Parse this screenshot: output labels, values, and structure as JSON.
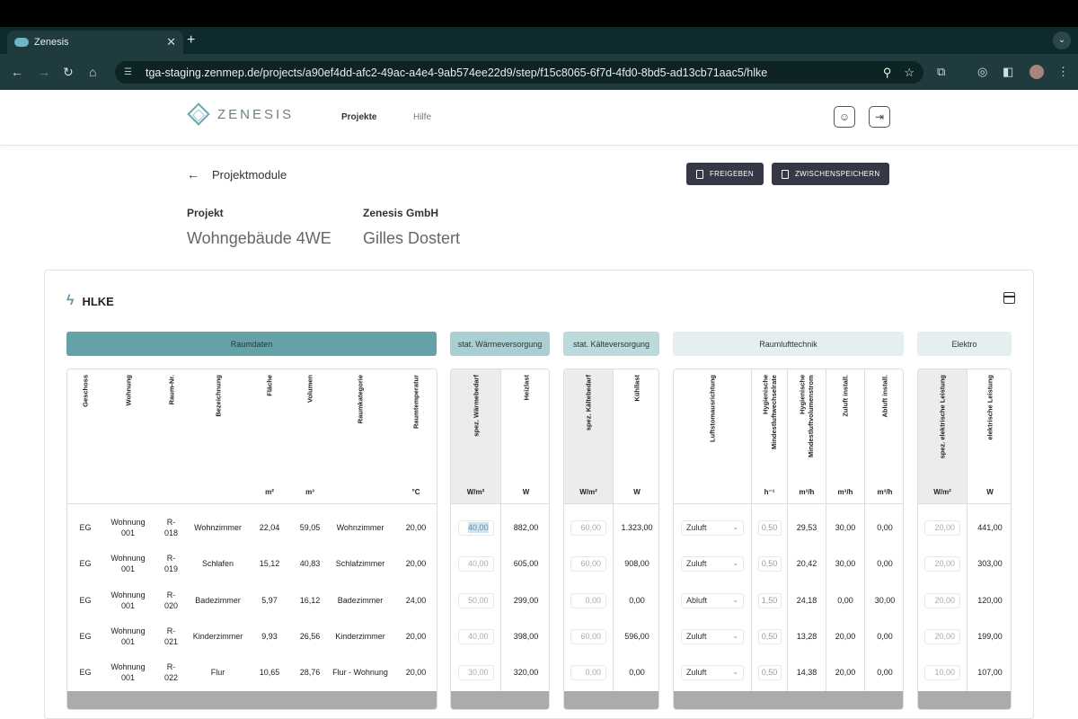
{
  "browser": {
    "tab_title": "Zenesis",
    "url": "tga-staging.zenmep.de/projects/a90ef4dd-afc2-49ac-a4e4-9ab574ee22d9/step/f15c8065-6f7d-4fd0-8bd5-ad13cb71aac5/hlke"
  },
  "app": {
    "brand": "ZENESIS",
    "menu_projects": "Projekte",
    "menu_help": "Hilfe"
  },
  "page": {
    "back_label": "Projektmodule",
    "btn_release": "FREIGEBEN",
    "btn_save": "ZWISCHENSPEICHERN",
    "project_label": "Projekt",
    "project_name": "Wohngebäude 4WE",
    "company_label": "Zenesis GmbH",
    "company_user": "Gilles Dostert"
  },
  "module": {
    "title": "HLKE"
  },
  "groups": [
    "Raumdaten",
    "stat. Wärmeversorgung",
    "stat. Kälteversorgung",
    "Raumlufttechnik",
    "Elektro"
  ],
  "columns": {
    "geschoss": {
      "label": "Geschoss",
      "unit": ""
    },
    "wohnung": {
      "label": "Wohnung",
      "unit": ""
    },
    "raumnr": {
      "label": "Raum-Nr.",
      "unit": ""
    },
    "bez": {
      "label": "Bezeichnung",
      "unit": ""
    },
    "flaeche": {
      "label": "Fläche",
      "unit": "m²"
    },
    "volumen": {
      "label": "Volumen",
      "unit": "m³"
    },
    "kat": {
      "label": "Raumkategorie",
      "unit": ""
    },
    "temp": {
      "label": "Raumtemperatur",
      "unit": "°C"
    },
    "swb": {
      "label": "spez. Wärmebedarf",
      "unit": "W/m²"
    },
    "heiz": {
      "label": "Heizlast",
      "unit": "W"
    },
    "skb": {
      "label": "spez. Kältebedarf",
      "unit": "W/m²"
    },
    "kuehl": {
      "label": "Kühllast",
      "unit": "W"
    },
    "lr": {
      "label": "Luftstomausrichtung",
      "unit": ""
    },
    "hmlw": {
      "label": "Hygienische Mindestluftwechselrate",
      "unit": "h⁻¹"
    },
    "hmlv": {
      "label": "Hygienische Mindestluftvolumenstrom",
      "unit": "m³/h"
    },
    "zu": {
      "label": "Zuluft install.",
      "unit": "m³/h"
    },
    "ab": {
      "label": "Abluft install.",
      "unit": "m³/h"
    },
    "sel": {
      "label": "spez. elektrische Leistung",
      "unit": "W/m²"
    },
    "el": {
      "label": "elektrische Leistung",
      "unit": "W"
    }
  },
  "rows": [
    {
      "geschoss": "EG",
      "wohnung": "Wohnung 001",
      "raumnr": "R-018",
      "bez": "Wohnzimmer",
      "flaeche": "22,04",
      "volumen": "59,05",
      "kat": "Wohnzimmer",
      "temp": "20,00",
      "swb": "40,00",
      "heiz": "882,00",
      "skb": "60,00",
      "kuehl": "1.323,00",
      "lr": "Zuluft",
      "hmlw": "0,50",
      "hmlv": "29,53",
      "zu": "30,00",
      "ab": "0,00",
      "sel": "20,00",
      "el": "441,00"
    },
    {
      "geschoss": "EG",
      "wohnung": "Wohnung 001",
      "raumnr": "R-019",
      "bez": "Schlafen",
      "flaeche": "15,12",
      "volumen": "40,83",
      "kat": "Schlafzimmer",
      "temp": "20,00",
      "swb": "40,00",
      "heiz": "605,00",
      "skb": "60,00",
      "kuehl": "908,00",
      "lr": "Zuluft",
      "hmlw": "0,50",
      "hmlv": "20,42",
      "zu": "30,00",
      "ab": "0,00",
      "sel": "20,00",
      "el": "303,00"
    },
    {
      "geschoss": "EG",
      "wohnung": "Wohnung 001",
      "raumnr": "R-020",
      "bez": "Badezimmer",
      "flaeche": "5,97",
      "volumen": "16,12",
      "kat": "Badezimmer",
      "temp": "24,00",
      "swb": "50,00",
      "heiz": "299,00",
      "skb": "0,00",
      "kuehl": "0,00",
      "lr": "Abluft",
      "hmlw": "1,50",
      "hmlv": "24,18",
      "zu": "0,00",
      "ab": "30,00",
      "sel": "20,00",
      "el": "120,00"
    },
    {
      "geschoss": "EG",
      "wohnung": "Wohnung 001",
      "raumnr": "R-021",
      "bez": "Kinderzimmer",
      "flaeche": "9,93",
      "volumen": "26,56",
      "kat": "Kinderzimmer",
      "temp": "20,00",
      "swb": "40,00",
      "heiz": "398,00",
      "skb": "60,00",
      "kuehl": "596,00",
      "lr": "Zuluft",
      "hmlw": "0,50",
      "hmlv": "13,28",
      "zu": "20,00",
      "ab": "0,00",
      "sel": "20,00",
      "el": "199,00"
    },
    {
      "geschoss": "EG",
      "wohnung": "Wohnung 001",
      "raumnr": "R-022",
      "bez": "Flur",
      "flaeche": "10,65",
      "volumen": "28,76",
      "kat": "Flur - Wohnung",
      "temp": "20,00",
      "swb": "30,00",
      "heiz": "320,00",
      "skb": "0,00",
      "kuehl": "0,00",
      "lr": "Zuluft",
      "hmlw": "0,50",
      "hmlv": "14,38",
      "zu": "20,00",
      "ab": "0,00",
      "sel": "10,00",
      "el": "107,00"
    }
  ],
  "colors": {
    "raumdaten": "#65a2a8",
    "waerme": "#a9cfd3",
    "kaelte": "#bcd9db",
    "rlt": "#e6eff0",
    "elektro": "#e6eff0",
    "button": "#363847"
  }
}
